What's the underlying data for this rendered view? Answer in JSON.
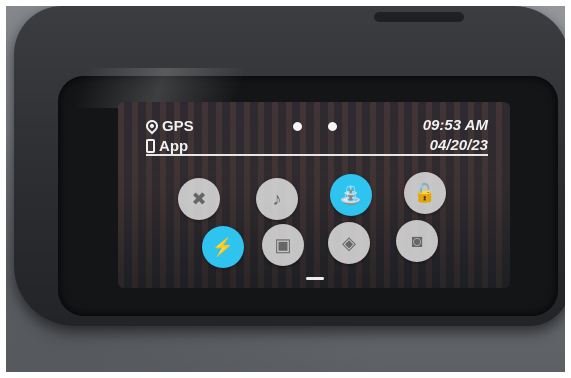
{
  "status": {
    "gps_label": "GPS",
    "app_label": "App",
    "time": "09:53 AM",
    "date": "04/20/23"
  },
  "controls": {
    "row1": [
      {
        "icon": "voice-off-icon",
        "glyph": "✖",
        "active": false
      },
      {
        "icon": "music-note-icon",
        "glyph": "♪",
        "active": false
      },
      {
        "icon": "hydro-mode-icon",
        "glyph": "⛲",
        "active": true
      },
      {
        "icon": "unlock-icon",
        "glyph": "🔓",
        "active": false
      }
    ],
    "row2": [
      {
        "icon": "lightning-icon",
        "glyph": "⚡",
        "active": true
      },
      {
        "icon": "portrait-frame-icon",
        "glyph": "▣",
        "active": false
      },
      {
        "icon": "orientation-icon",
        "glyph": "◈",
        "active": false
      },
      {
        "icon": "screen-icon",
        "glyph": "◙",
        "active": false
      }
    ]
  },
  "colors": {
    "accent": "#2fc4f0",
    "button": "#e1e1e1"
  }
}
